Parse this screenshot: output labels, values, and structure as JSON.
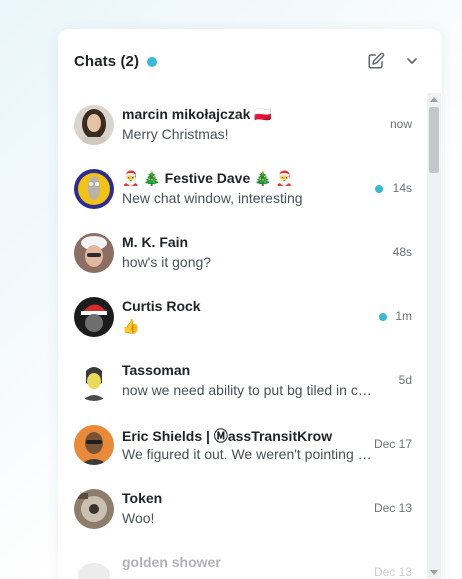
{
  "header": {
    "title": "Chats (2)",
    "status_color": "#3ab8d8",
    "compose_icon": "compose-icon",
    "collapse_icon": "chevron-down-icon"
  },
  "chats": [
    {
      "name": "marcin mikołajczak 🇵🇱",
      "message": "Merry Christmas!",
      "time": "now",
      "unread": false
    },
    {
      "name": "🎅 🎄 Festive Dave 🎄 🎅",
      "message": "New chat window, interesting",
      "time": "14s",
      "unread": true
    },
    {
      "name": "M. K. Fain",
      "message": "how's it gong?",
      "time": "48s",
      "unread": false
    },
    {
      "name": "Curtis Rock",
      "message": "👍",
      "time": "1m",
      "unread": true
    },
    {
      "name": "Tassoman",
      "message": "now we need ability to put bg tiled in chat",
      "time": "5d",
      "unread": false
    },
    {
      "name": "Eric Shields | ⓂassTransitKrow",
      "message": "We figured it out. We weren't pointing to it",
      "time": "Dec 17",
      "unread": false
    },
    {
      "name": "Token",
      "message": "Woo!",
      "time": "Dec 13",
      "unread": false
    },
    {
      "name": "golden shower",
      "message": "",
      "time": "Dec 13",
      "unread": false
    }
  ]
}
